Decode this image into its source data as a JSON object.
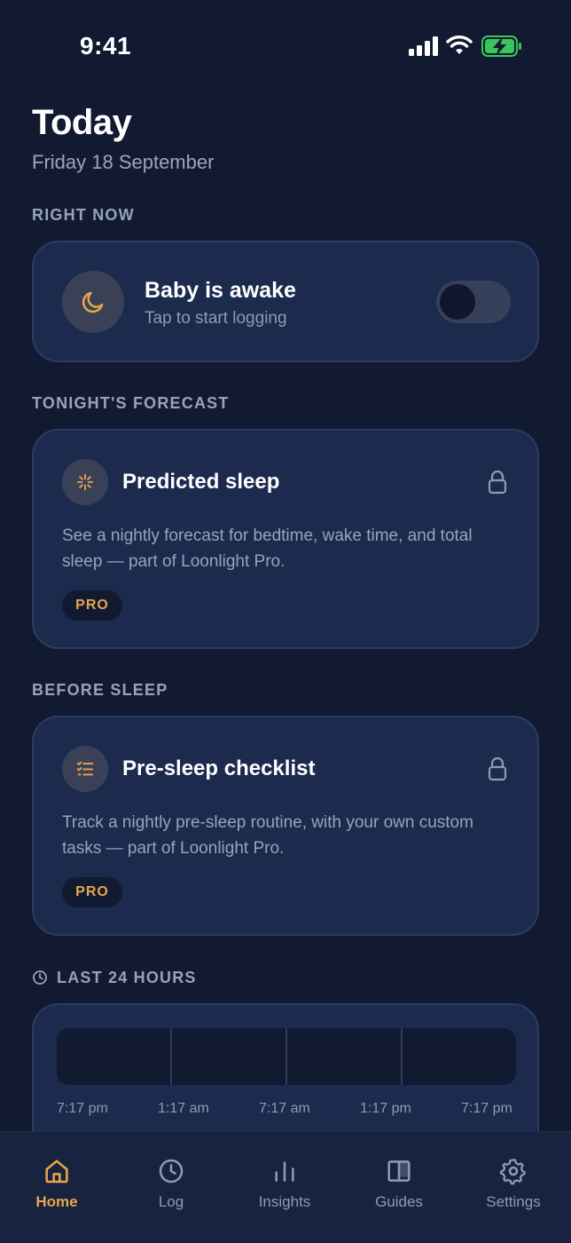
{
  "status_bar": {
    "time": "9:41"
  },
  "header": {
    "title": "Today",
    "date": "Friday 18 September"
  },
  "right_now": {
    "section_label": "RIGHT NOW",
    "title": "Baby is awake",
    "subtitle": "Tap to start logging",
    "toggle_on": false
  },
  "forecast": {
    "section_label": "TONIGHT'S FORECAST",
    "title": "Predicted sleep",
    "description": "See a nightly forecast for bedtime, wake time, and total sleep — part of Loonlight Pro.",
    "badge": "PRO"
  },
  "before_sleep": {
    "section_label": "BEFORE SLEEP",
    "title": "Pre-sleep checklist",
    "description": "Track a nightly pre-sleep routine, with your own custom tasks — part of Loonlight Pro.",
    "badge": "PRO"
  },
  "last_24": {
    "section_label": "LAST 24 HOURS",
    "times": [
      "7:17 pm",
      "1:17 am",
      "7:17 am",
      "1:17 pm",
      "7:17 pm"
    ]
  },
  "tabs": [
    {
      "label": "Home",
      "icon": "home-icon",
      "active": true
    },
    {
      "label": "Log",
      "icon": "clock-icon",
      "active": false
    },
    {
      "label": "Insights",
      "icon": "bar-chart-icon",
      "active": false
    },
    {
      "label": "Guides",
      "icon": "book-icon",
      "active": false
    },
    {
      "label": "Settings",
      "icon": "gear-icon",
      "active": false
    }
  ],
  "colors": {
    "accent": "#e8a64a",
    "background": "#111a31",
    "card": "#1b2a4d",
    "battery": "#3cc45c"
  }
}
